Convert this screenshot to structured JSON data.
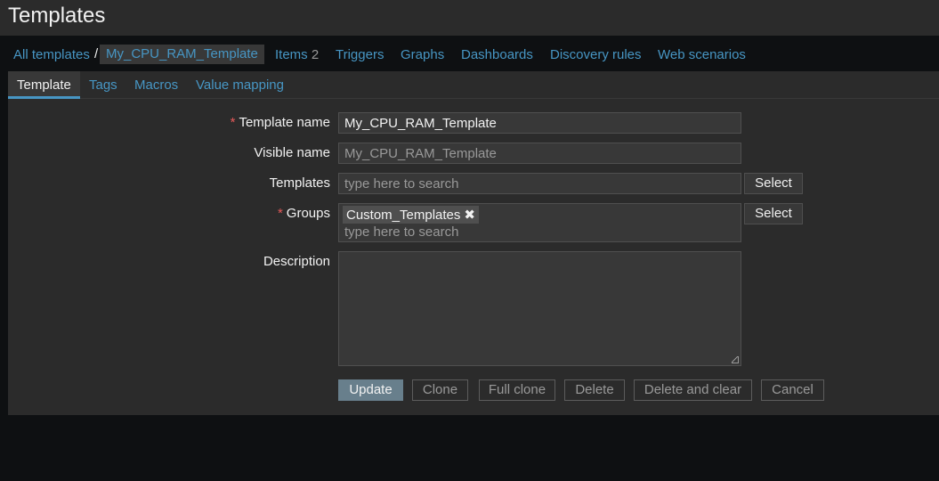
{
  "page": {
    "title": "Templates"
  },
  "nav": {
    "all_templates": "All templates",
    "separator": "/",
    "current": "My_CPU_RAM_Template",
    "items_label": "Items",
    "items_count": "2",
    "triggers": "Triggers",
    "graphs": "Graphs",
    "dashboards": "Dashboards",
    "discovery_rules": "Discovery rules",
    "web_scenarios": "Web scenarios"
  },
  "tabs": {
    "template": "Template",
    "tags": "Tags",
    "macros": "Macros",
    "value_mapping": "Value mapping"
  },
  "form": {
    "required_mark": "*",
    "template_name_label": "Template name",
    "template_name_value": "My_CPU_RAM_Template",
    "visible_name_label": "Visible name",
    "visible_name_placeholder": "My_CPU_RAM_Template",
    "templates_label": "Templates",
    "templates_placeholder": "type here to search",
    "groups_label": "Groups",
    "groups_chip": "Custom_Templates",
    "groups_chip_remove": "✖",
    "groups_placeholder": "type here to search",
    "description_label": "Description",
    "description_value": "",
    "select_label": "Select"
  },
  "buttons": {
    "update": "Update",
    "clone": "Clone",
    "full_clone": "Full clone",
    "delete": "Delete",
    "delete_and_clear": "Delete and clear",
    "cancel": "Cancel"
  },
  "colors": {
    "background": "#0e1012",
    "panel": "#2b2b2b",
    "field": "#383838",
    "link": "#4796c4",
    "required": "#e45959",
    "primary_button": "#687f8c"
  }
}
